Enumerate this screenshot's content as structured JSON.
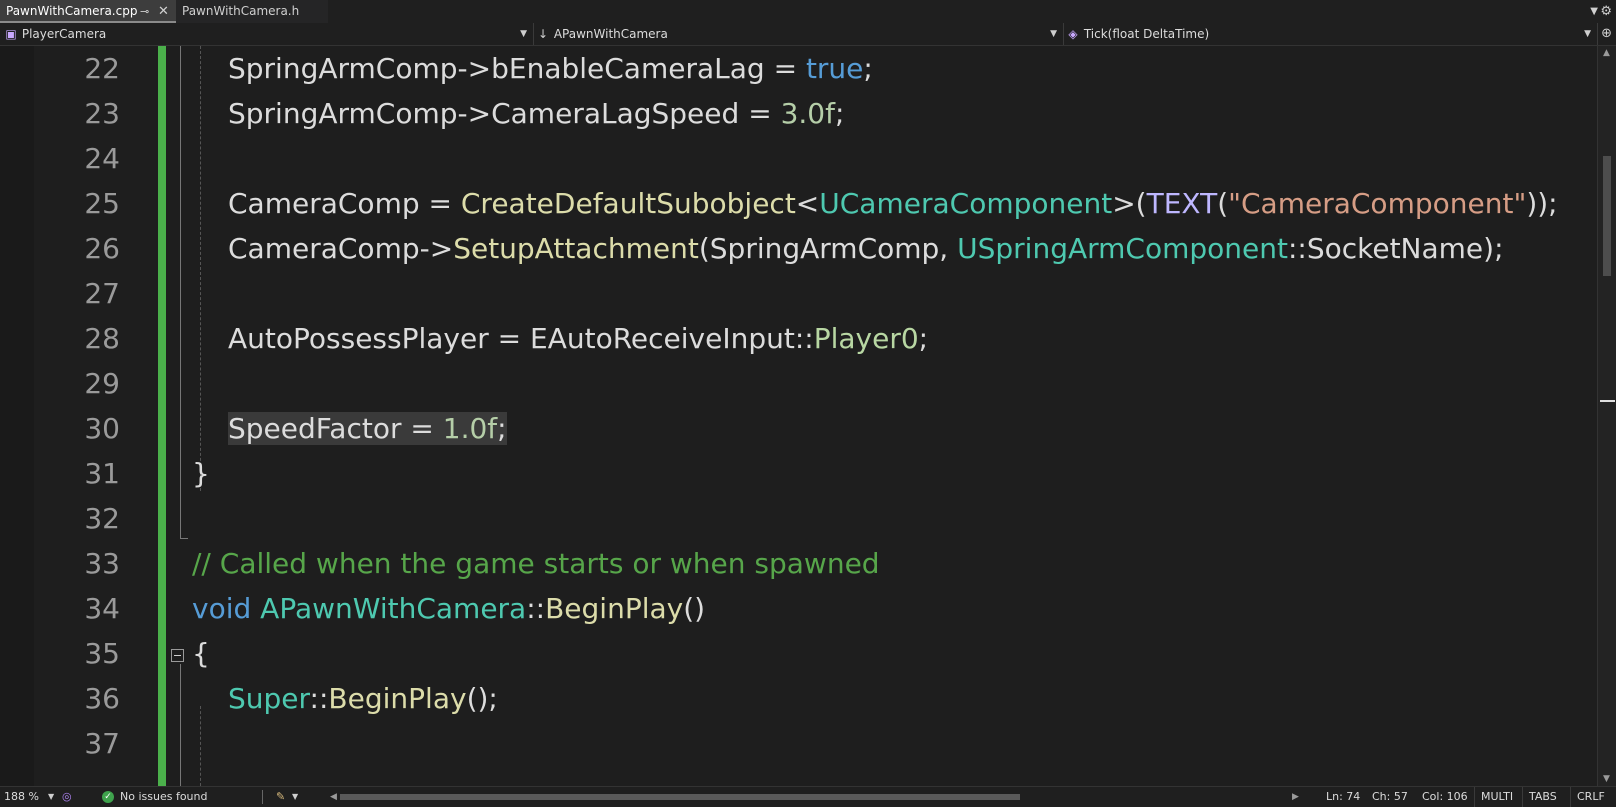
{
  "tabs": [
    {
      "label": "PawnWithCamera.cpp",
      "active": true,
      "pin_icon": "pin-icon",
      "close_icon": "close-icon"
    },
    {
      "label": "PawnWithCamera.h",
      "active": false
    }
  ],
  "navbar": {
    "project": "PlayerCamera",
    "class_scope": "APawnWithCamera",
    "member": "Tick(float DeltaTime)"
  },
  "editor": {
    "lines": [
      {
        "num": "22",
        "text": "SpringArmComp->bEnableCameraLag = true;"
      },
      {
        "num": "23",
        "text": "SpringArmComp->CameraLagSpeed = 3.0f;"
      },
      {
        "num": "24",
        "text": ""
      },
      {
        "num": "25",
        "text": "CameraComp = CreateDefaultSubobject<UCameraComponent>(TEXT(\"CameraComponent\"));"
      },
      {
        "num": "26",
        "text": "CameraComp->SetupAttachment(SpringArmComp, USpringArmComponent::SocketName);"
      },
      {
        "num": "27",
        "text": ""
      },
      {
        "num": "28",
        "text": "AutoPossessPlayer = EAutoReceiveInput::Player0;"
      },
      {
        "num": "29",
        "text": ""
      },
      {
        "num": "30",
        "text": "SpeedFactor = 1.0f;"
      },
      {
        "num": "31",
        "text": "}"
      },
      {
        "num": "32",
        "text": ""
      },
      {
        "num": "33",
        "text": "// Called when the game starts or when spawned"
      },
      {
        "num": "34",
        "text": "void APawnWithCamera::BeginPlay()"
      },
      {
        "num": "35",
        "text": "{"
      },
      {
        "num": "36",
        "text": "Super::BeginPlay();"
      },
      {
        "num": "37",
        "text": ""
      }
    ],
    "highlighted_line": "30",
    "colors": {
      "keyword": "#569cd6",
      "type": "#4ec9b0",
      "function": "#dcdcaa",
      "number": "#b5cea8",
      "string": "#d69d85",
      "comment": "#57a64a",
      "macro": "#beb7ff",
      "enum_member": "#b8d7a3",
      "change_bar": "#4bb04b"
    }
  },
  "statusbar": {
    "zoom": "188 %",
    "issues": "No issues found",
    "line": "Ln: 74",
    "char": "Ch: 57",
    "col": "Col: 106",
    "selection_mode": "MULTI",
    "indent": "TABS",
    "line_ending": "CRLF"
  }
}
